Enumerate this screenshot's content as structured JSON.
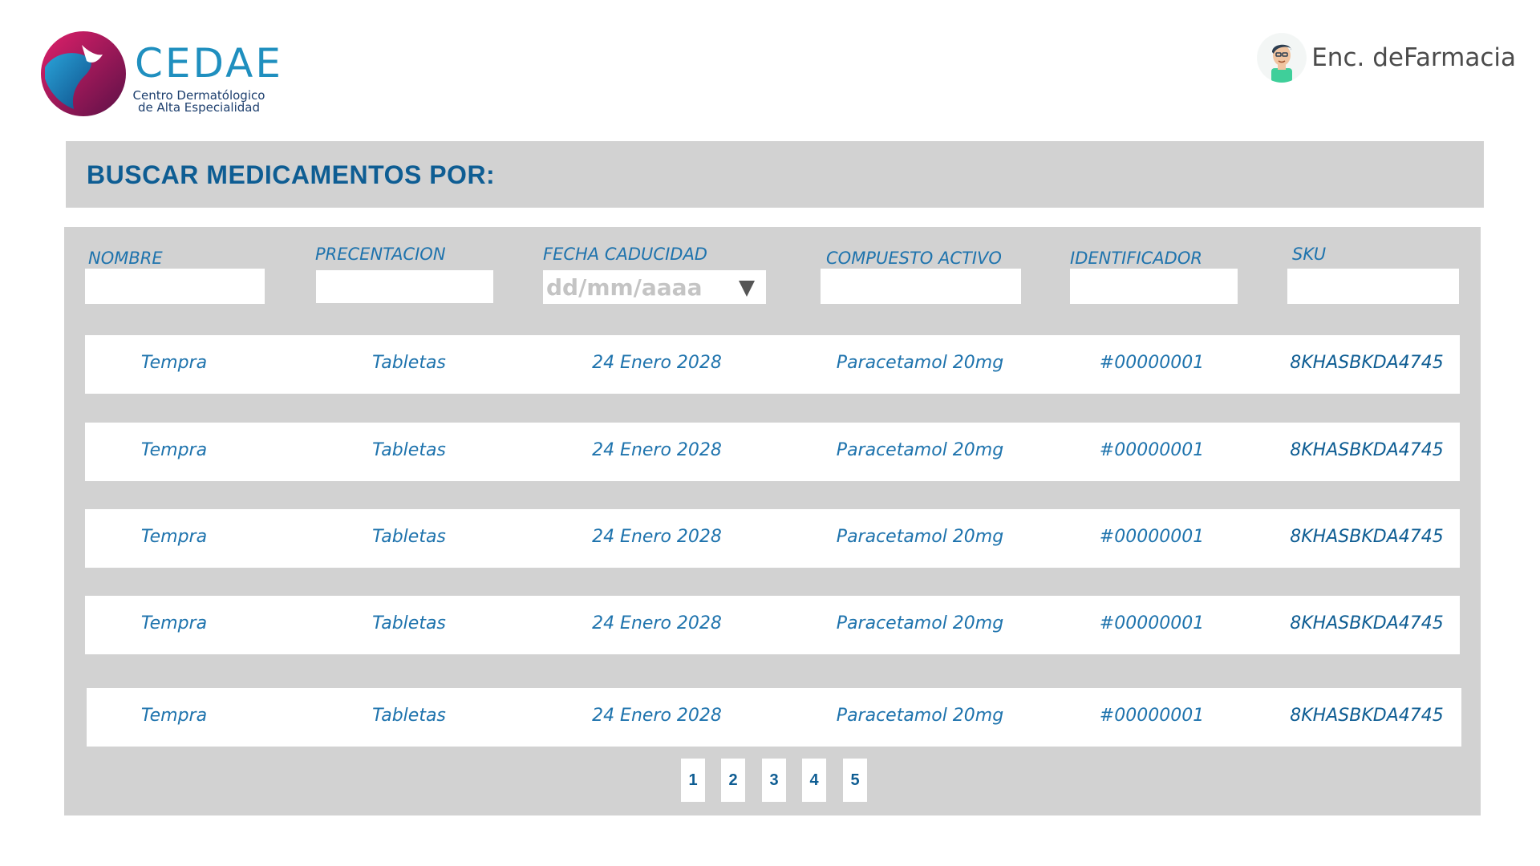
{
  "brand": {
    "name": "CEDAE",
    "subtitle_line1": "Centro Dermatólogico",
    "subtitle_line2": "de Alta Especialidad"
  },
  "user": {
    "name": "Enc. deFarmacia",
    "icon": "person-avatar-icon"
  },
  "search": {
    "title": "BUSCAR MEDICAMENTOS POR:"
  },
  "filters": {
    "nombre": {
      "label": "NOMBRE",
      "value": ""
    },
    "presentacion": {
      "label": "PRECENTACION",
      "value": ""
    },
    "fecha": {
      "label": "FECHA CADUCIDAD",
      "placeholder": "dd/mm/aaaa",
      "icon": "dropdown-triangle-icon"
    },
    "compuesto": {
      "label": "COMPUESTO ACTIVO",
      "value": ""
    },
    "identificador": {
      "label": "IDENTIFICADOR",
      "value": ""
    },
    "sku": {
      "label": "SKU",
      "value": ""
    }
  },
  "results": [
    {
      "nombre": "Tempra",
      "presentacion": "Tabletas",
      "fecha": "24 Enero 2028",
      "compuesto": "Paracetamol 20mg",
      "identificador": "#00000001",
      "sku": "8KHASBKDA4745"
    },
    {
      "nombre": "Tempra",
      "presentacion": "Tabletas",
      "fecha": "24 Enero 2028",
      "compuesto": "Paracetamol 20mg",
      "identificador": "#00000001",
      "sku": "8KHASBKDA4745"
    },
    {
      "nombre": "Tempra",
      "presentacion": "Tabletas",
      "fecha": "24 Enero 2028",
      "compuesto": "Paracetamol 20mg",
      "identificador": "#00000001",
      "sku": "8KHASBKDA4745"
    },
    {
      "nombre": "Tempra",
      "presentacion": "Tabletas",
      "fecha": "24 Enero 2028",
      "compuesto": "Paracetamol 20mg",
      "identificador": "#00000001",
      "sku": "8KHASBKDA4745"
    },
    {
      "nombre": "Tempra",
      "presentacion": "Tabletas",
      "fecha": "24 Enero 2028",
      "compuesto": "Paracetamol 20mg",
      "identificador": "#00000001",
      "sku": "8KHASBKDA4745"
    }
  ],
  "pagination": {
    "pages": [
      "1",
      "2",
      "3",
      "4",
      "5"
    ]
  },
  "colors": {
    "accent": "#0e5d93",
    "label_blue": "#1e73ad",
    "panel_gray": "#d2d2d2",
    "logo_blue": "#1f8fbf",
    "logo_magenta": "#c2185b"
  }
}
